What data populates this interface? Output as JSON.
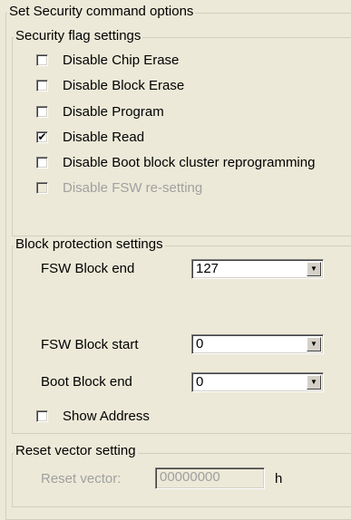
{
  "outer_group": {
    "title": "Set Security command options"
  },
  "security_flags": {
    "title": "Security flag settings",
    "items": [
      {
        "label": "Disable Chip Erase",
        "checked": false,
        "enabled": true
      },
      {
        "label": "Disable Block Erase",
        "checked": false,
        "enabled": true
      },
      {
        "label": "Disable Program",
        "checked": false,
        "enabled": true
      },
      {
        "label": "Disable Read",
        "checked": true,
        "enabled": true
      },
      {
        "label": "Disable Boot block cluster reprogramming",
        "checked": false,
        "enabled": true
      },
      {
        "label": "Disable FSW re-setting",
        "checked": false,
        "enabled": false
      }
    ]
  },
  "block_protection": {
    "title": "Block protection settings",
    "fsw_block_end": {
      "label": "FSW Block end",
      "value": "127"
    },
    "fsw_block_start": {
      "label": "FSW Block start",
      "value": "0"
    },
    "boot_block_end": {
      "label": "Boot Block end",
      "value": "0"
    },
    "show_address": {
      "label": "Show Address",
      "checked": false
    }
  },
  "reset_vector": {
    "title": "Reset vector setting",
    "label": "Reset vector:",
    "value": "00000000",
    "unit": "h",
    "enabled": false
  },
  "glyphs": {
    "dropdown_arrow": "▼",
    "check_mark": "✔"
  }
}
